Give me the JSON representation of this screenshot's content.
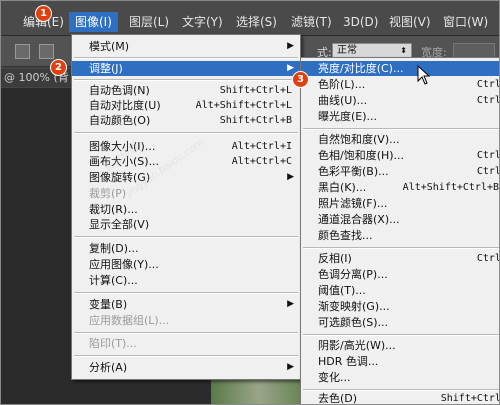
{
  "menubar": {
    "items": [
      {
        "label": "编辑(E)"
      },
      {
        "label": "图像(I)"
      },
      {
        "label": "图层(L)"
      },
      {
        "label": "文字(Y)"
      },
      {
        "label": "选择(S)"
      },
      {
        "label": "滤镜(T)"
      },
      {
        "label": "3D(D)"
      },
      {
        "label": "视图(V)"
      },
      {
        "label": "窗口(W)"
      }
    ]
  },
  "options_bar": {
    "style_label": "式:",
    "mode_value": "正常",
    "width_label": "宽度:"
  },
  "document_tab": "@ 100% (背",
  "watermark": [
    "百度经验",
    "jingyan.baidu.com"
  ],
  "image_menu": {
    "items": [
      {
        "label": "模式(M)",
        "shortcut": "",
        "submenu": true
      },
      {
        "label": "调整(J)",
        "shortcut": "",
        "submenu": true
      },
      {
        "label": "自动色调(N)",
        "shortcut": "Shift+Ctrl+L"
      },
      {
        "label": "自动对比度(U)",
        "shortcut": "Alt+Shift+Ctrl+L"
      },
      {
        "label": "自动颜色(O)",
        "shortcut": "Shift+Ctrl+B"
      },
      {
        "label": "图像大小(I)...",
        "shortcut": "Alt+Ctrl+I"
      },
      {
        "label": "画布大小(S)...",
        "shortcut": "Alt+Ctrl+C"
      },
      {
        "label": "图像旋转(G)",
        "shortcut": "",
        "submenu": true
      },
      {
        "label": "裁剪(P)",
        "shortcut": "",
        "disabled": true
      },
      {
        "label": "裁切(R)...",
        "shortcut": ""
      },
      {
        "label": "显示全部(V)",
        "shortcut": ""
      },
      {
        "label": "复制(D)...",
        "shortcut": ""
      },
      {
        "label": "应用图像(Y)...",
        "shortcut": ""
      },
      {
        "label": "计算(C)...",
        "shortcut": ""
      },
      {
        "label": "变量(B)",
        "shortcut": "",
        "submenu": true
      },
      {
        "label": "应用数据组(L)...",
        "shortcut": "",
        "disabled": true
      },
      {
        "label": "陷印(T)...",
        "shortcut": "",
        "disabled": true
      },
      {
        "label": "分析(A)",
        "shortcut": "",
        "submenu": true
      }
    ]
  },
  "adjust_menu": {
    "items": [
      {
        "label": "亮度/对比度(C)...",
        "shortcut": ""
      },
      {
        "label": "色阶(L)...",
        "shortcut": "Ctrl+L"
      },
      {
        "label": "曲线(U)...",
        "shortcut": "Ctrl+M"
      },
      {
        "label": "曝光度(E)...",
        "shortcut": ""
      },
      {
        "label": "自然饱和度(V)...",
        "shortcut": ""
      },
      {
        "label": "色相/饱和度(H)...",
        "shortcut": "Ctrl+U"
      },
      {
        "label": "色彩平衡(B)...",
        "shortcut": "Ctrl+B"
      },
      {
        "label": "黑白(K)...",
        "shortcut": "Alt+Shift+Ctrl+B"
      },
      {
        "label": "照片滤镜(F)...",
        "shortcut": ""
      },
      {
        "label": "通道混合器(X)...",
        "shortcut": ""
      },
      {
        "label": "颜色查找...",
        "shortcut": ""
      },
      {
        "label": "反相(I)",
        "shortcut": "Ctrl+I"
      },
      {
        "label": "色调分离(P)...",
        "shortcut": ""
      },
      {
        "label": "阈值(T)...",
        "shortcut": ""
      },
      {
        "label": "渐变映射(G)...",
        "shortcut": ""
      },
      {
        "label": "可选颜色(S)...",
        "shortcut": ""
      },
      {
        "label": "阴影/高光(W)...",
        "shortcut": ""
      },
      {
        "label": "HDR 色调...",
        "shortcut": ""
      },
      {
        "label": "变化...",
        "shortcut": ""
      },
      {
        "label": "去色(D)",
        "shortcut": "Shift+Ctrl+U"
      }
    ]
  },
  "badges": [
    "1",
    "2",
    "3"
  ],
  "colors": {
    "menubar_bg": "#4a4a4a",
    "highlight": "#2e6fc2",
    "badge": "#e04010",
    "menu_bg": "#f0f0f0"
  }
}
